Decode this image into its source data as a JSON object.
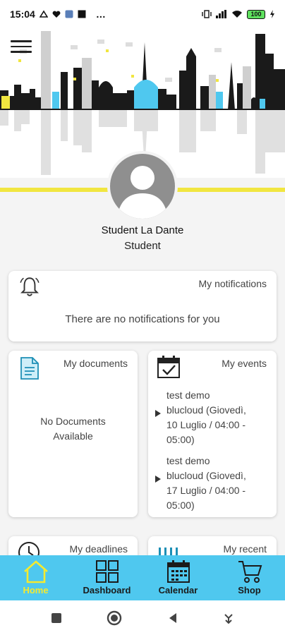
{
  "status_bar": {
    "time": "15:04",
    "battery": "100",
    "more_icon": "…"
  },
  "user": {
    "name": "Student La Dante",
    "role": "Student"
  },
  "notifications": {
    "title": "My notifications",
    "empty_text": "There are no notifications for you"
  },
  "documents": {
    "title": "My documents",
    "empty_line1": "No Documents",
    "empty_line2": "Available"
  },
  "events": {
    "title": "My events",
    "items": [
      {
        "line1": "test demo",
        "line2": "blucloud (Giovedì,",
        "line3": "10 Luglio / 04:00 -",
        "line4": "05:00)"
      },
      {
        "line1": "test demo",
        "line2": "blucloud (Giovedì,",
        "line3": "17 Luglio / 04:00 -",
        "line4": "05:00)"
      }
    ]
  },
  "deadlines": {
    "title": "My deadlines"
  },
  "recent": {
    "title": "My recent"
  },
  "bottom_nav": {
    "items": [
      {
        "label": "Home",
        "icon": "home-icon",
        "active": true
      },
      {
        "label": "Dashboard",
        "icon": "dashboard-icon",
        "active": false
      },
      {
        "label": "Calendar",
        "icon": "calendar-icon",
        "active": false
      },
      {
        "label": "Shop",
        "icon": "cart-icon",
        "active": false
      }
    ]
  },
  "colors": {
    "accent_yellow": "#f1e640",
    "nav_blue": "#4fc8ef",
    "active_label": "#f5ea2f"
  }
}
